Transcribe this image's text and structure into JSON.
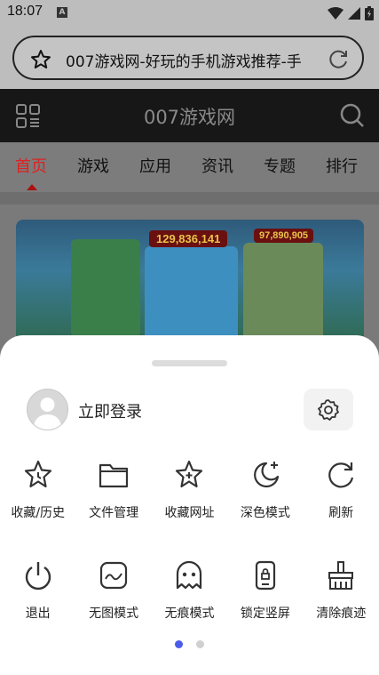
{
  "status_bar": {
    "time": "18:07",
    "notification_icon": "A"
  },
  "url_bar": {
    "text": "007游戏网-好玩的手机游戏推荐-手"
  },
  "site_header": {
    "title": "007游戏网"
  },
  "nav": {
    "items": [
      "首页",
      "游戏",
      "应用",
      "资讯",
      "专题",
      "排行"
    ],
    "active_index": 0
  },
  "banner": {
    "jackpot_1": "129,836,141",
    "jackpot_2": "97,890,905"
  },
  "sheet": {
    "login_label": "立即登录",
    "row1": [
      {
        "label": "收藏/历史",
        "icon": "star-history-icon"
      },
      {
        "label": "文件管理",
        "icon": "folder-icon"
      },
      {
        "label": "收藏网址",
        "icon": "star-plus-icon"
      },
      {
        "label": "深色模式",
        "icon": "moon-icon"
      },
      {
        "label": "刷新",
        "icon": "refresh-icon"
      }
    ],
    "row2": [
      {
        "label": "退出",
        "icon": "power-icon"
      },
      {
        "label": "无图模式",
        "icon": "no-image-icon"
      },
      {
        "label": "无痕模式",
        "icon": "ghost-icon"
      },
      {
        "label": "锁定竖屏",
        "icon": "lock-portrait-icon"
      },
      {
        "label": "清除痕迹",
        "icon": "broom-icon"
      }
    ],
    "page_count": 2,
    "current_page": 1
  },
  "colors": {
    "accent": "#4b5bea",
    "nav_active": "#d22222"
  }
}
